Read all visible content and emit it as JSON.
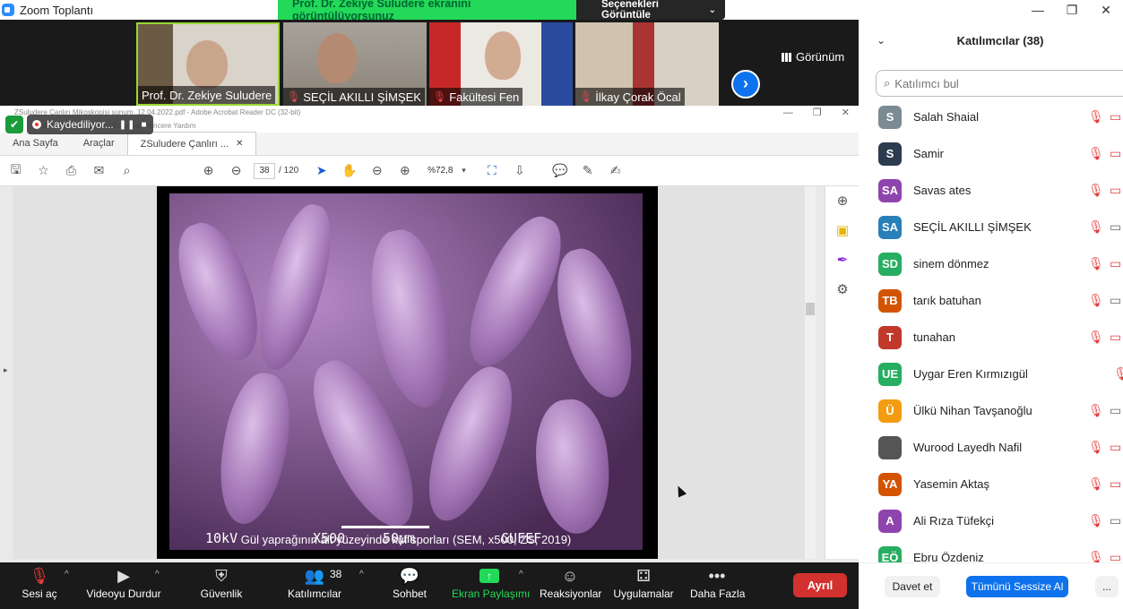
{
  "titlebar": {
    "app_title": "Zoom Toplantı",
    "sharing_banner": "Prof. Dr. Zekiye Suludere ekranını görüntülüyorsunuz",
    "view_options": "Seçenekleri Görüntüle"
  },
  "videos": [
    {
      "name": "Prof. Dr. Zekiye Suludere",
      "muted": false
    },
    {
      "name": "SEÇİL AKILLI ŞİMŞEK",
      "muted": true
    },
    {
      "name": "Fakültesi Fen",
      "muted": true
    },
    {
      "name": "İlkay Çorak Öcal",
      "muted": true
    }
  ],
  "view_label": "Görünüm",
  "recording": {
    "label": "Kaydediliyor..."
  },
  "acrobat": {
    "title": "ZSuludere Çanlırı Mikoskopisi sunum..12.04.2022.pdf - Adobe Acrobat Reader DC (32-bit)",
    "menu": "Dosya   Düzen   Görünüm   Oturum aç   Pencere   Yardım",
    "tabs": [
      "Ana Sayfa",
      "Araçlar",
      "ZSuludere Çanlırı ..."
    ],
    "page_current": "38",
    "page_total": "/ 120",
    "zoom": "%72,8"
  },
  "slide": {
    "sem_labels": [
      "10kV",
      "X500",
      "50μm",
      "GUFEF"
    ],
    "caption": "Gül yaprağının alt yüzeyinde küf sporları (SEM, x500, ZS, 2019)"
  },
  "toolbar": {
    "unmute": "Sesi aç",
    "stop_video": "Videoyu Durdur",
    "security": "Güvenlik",
    "participants": "Katılımcılar",
    "participants_count": "38",
    "chat": "Sohbet",
    "share_screen": "Ekran Paylaşımı",
    "reactions": "Reaksiyonlar",
    "apps": "Uygulamalar",
    "more": "Daha Fazla",
    "leave": "Ayrıl"
  },
  "panel": {
    "title": "Katılımcılar (38)",
    "search_placeholder": "Katılımcı bul",
    "participants": [
      {
        "initials": "S",
        "name": "Salah Shaial",
        "color": "#7b8a93",
        "cam": "off"
      },
      {
        "initials": "S",
        "name": "Samir",
        "color": "#2d3b4e",
        "cam": "off"
      },
      {
        "initials": "SA",
        "name": "Savas ates",
        "color": "#8e44ad",
        "cam": "off"
      },
      {
        "initials": "SA",
        "name": "SEÇİL AKILLI ŞİMŞEK",
        "color": "#2880b9",
        "cam": "on"
      },
      {
        "initials": "SD",
        "name": "sinem dönmez",
        "color": "#27ae60",
        "cam": "off"
      },
      {
        "initials": "TB",
        "name": "tarık batuhan",
        "color": "#d35400",
        "cam": "on"
      },
      {
        "initials": "T",
        "name": "tunahan",
        "color": "#c0392b",
        "cam": "off"
      },
      {
        "initials": "UE",
        "name": "Uygar Eren Kırmızıgül",
        "color": "#27ae60",
        "cam": "none"
      },
      {
        "initials": "Ü",
        "name": "Ülkü Nihan Tavşanoğlu",
        "color": "#f39c12",
        "cam": "on"
      },
      {
        "initials": "",
        "name": "Wurood Layedh Nafil",
        "color": "#555555",
        "cam": "off"
      },
      {
        "initials": "YA",
        "name": "Yasemin Aktaş",
        "color": "#d35400",
        "cam": "off"
      },
      {
        "initials": "A",
        "name": "Ali Rıza Tüfekçi",
        "color": "#8e44ad",
        "cam": "on"
      },
      {
        "initials": "EÖ",
        "name": "Ebru Özdeniz",
        "color": "#27ae60",
        "cam": "off"
      }
    ],
    "invite": "Davet et",
    "mute_all": "Tümünü Sessize Al",
    "more": "..."
  }
}
